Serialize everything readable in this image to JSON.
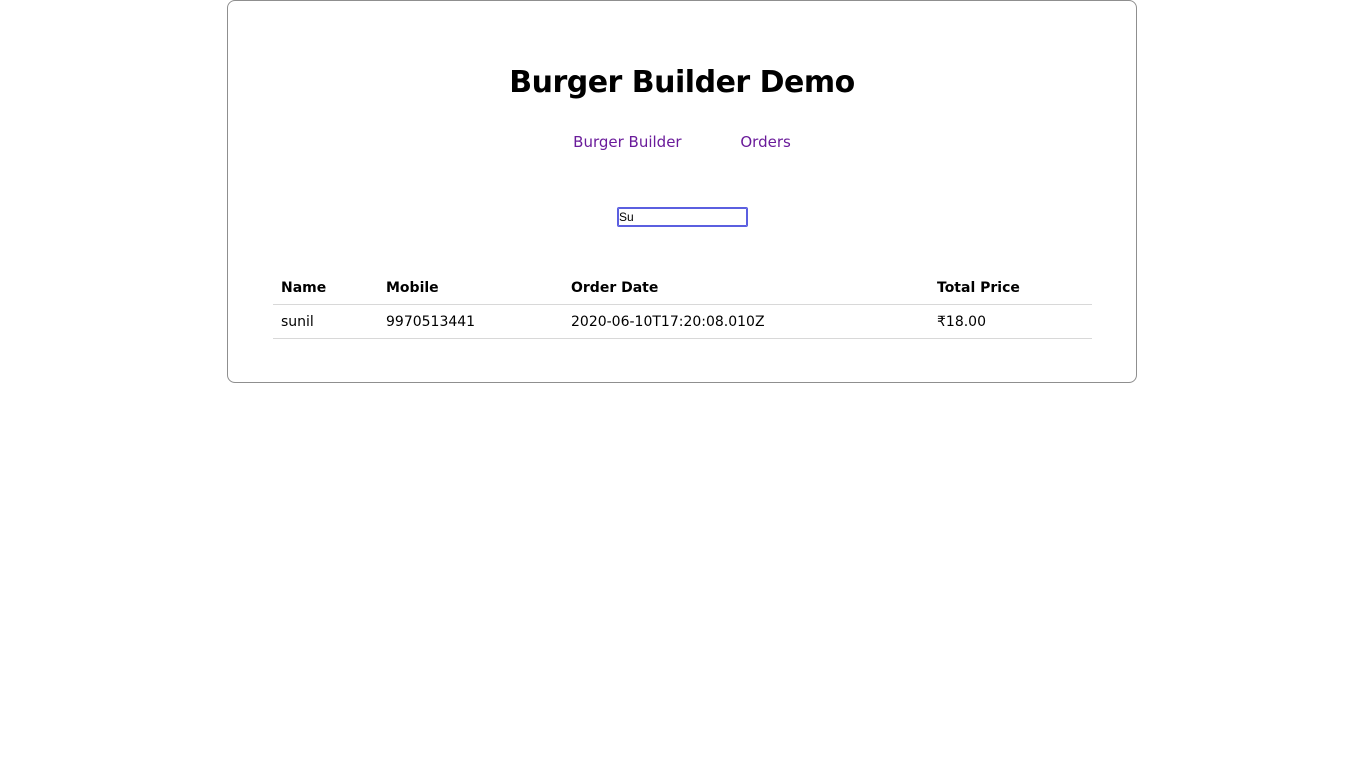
{
  "header": {
    "title": "Burger Builder Demo"
  },
  "nav": {
    "items": [
      {
        "label": "Burger Builder"
      },
      {
        "label": "Orders"
      }
    ]
  },
  "search": {
    "value": "Su"
  },
  "table": {
    "columns": [
      "Name",
      "Mobile",
      "Order Date",
      "Total Price"
    ],
    "rows": [
      {
        "name": "sunil",
        "mobile": "9970513441",
        "order_date": "2020-06-10T17:20:08.010Z",
        "total_price": "₹18.00"
      }
    ]
  },
  "colors": {
    "link": "#6a1b9a",
    "input_focus": "#5b5fe0",
    "card_border": "#8f8f8f"
  }
}
